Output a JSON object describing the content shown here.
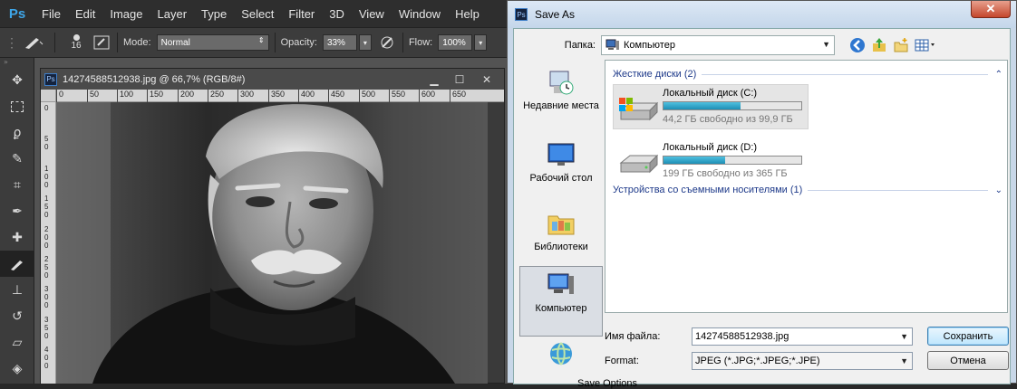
{
  "photoshop": {
    "logo": "Ps",
    "menu": [
      "File",
      "Edit",
      "Image",
      "Layer",
      "Type",
      "Select",
      "Filter",
      "3D",
      "View",
      "Window",
      "Help"
    ],
    "options": {
      "brush_size": "16",
      "mode_label": "Mode:",
      "mode_value": "Normal",
      "opacity_label": "Opacity:",
      "opacity_value": "33%",
      "flow_label": "Flow:",
      "flow_value": "100%"
    },
    "document": {
      "badge": "Ps",
      "title": "14274588512938.jpg @ 66,7% (RGB/8#)",
      "ruler_top": [
        "0",
        "50",
        "100",
        "150",
        "200",
        "250",
        "300",
        "350",
        "400",
        "450",
        "500",
        "550",
        "600",
        "650"
      ],
      "ruler_left": [
        "0",
        "5\n0",
        "1\n0\n0",
        "1\n5\n0",
        "2\n0\n0",
        "2\n5\n0",
        "3\n0\n0",
        "3\n5\n0",
        "4\n0\n0"
      ]
    },
    "tools": [
      "move-tool",
      "marquee-tool",
      "lasso-tool",
      "quick-select-tool",
      "crop-tool",
      "eyedropper-tool",
      "healing-tool",
      "brush-tool",
      "stamp-tool",
      "history-brush-tool",
      "eraser-tool",
      "bucket-tool",
      "blur-tool"
    ],
    "accent_color": "#3ea6e8"
  },
  "dialog": {
    "title": "Save As",
    "close_glyph": "✕",
    "folder_label": "Папка:",
    "folder_value": "Компьютер",
    "places": [
      "Недавние места",
      "Рабочий стол",
      "Библиотеки",
      "Компьютер"
    ],
    "groups": {
      "hard_drives": "Жесткие диски (2)",
      "removable": "Устройства со съемными носителями (1)"
    },
    "drives": [
      {
        "name": "Локальный диск (C:)",
        "info": "44,2 ГБ свободно из 99,9 ГБ",
        "used_fraction": 0.56
      },
      {
        "name": "Локальный диск (D:)",
        "info": "199 ГБ свободно из 365 ГБ",
        "used_fraction": 0.45
      }
    ],
    "filename_label": "Имя файла:",
    "filename_value": "14274588512938.jpg",
    "format_label": "Format:",
    "format_value": "JPEG (*.JPG;*.JPEG;*.JPE)",
    "save_button": "Сохранить",
    "cancel_button": "Отмена",
    "save_options": "Save Options"
  }
}
